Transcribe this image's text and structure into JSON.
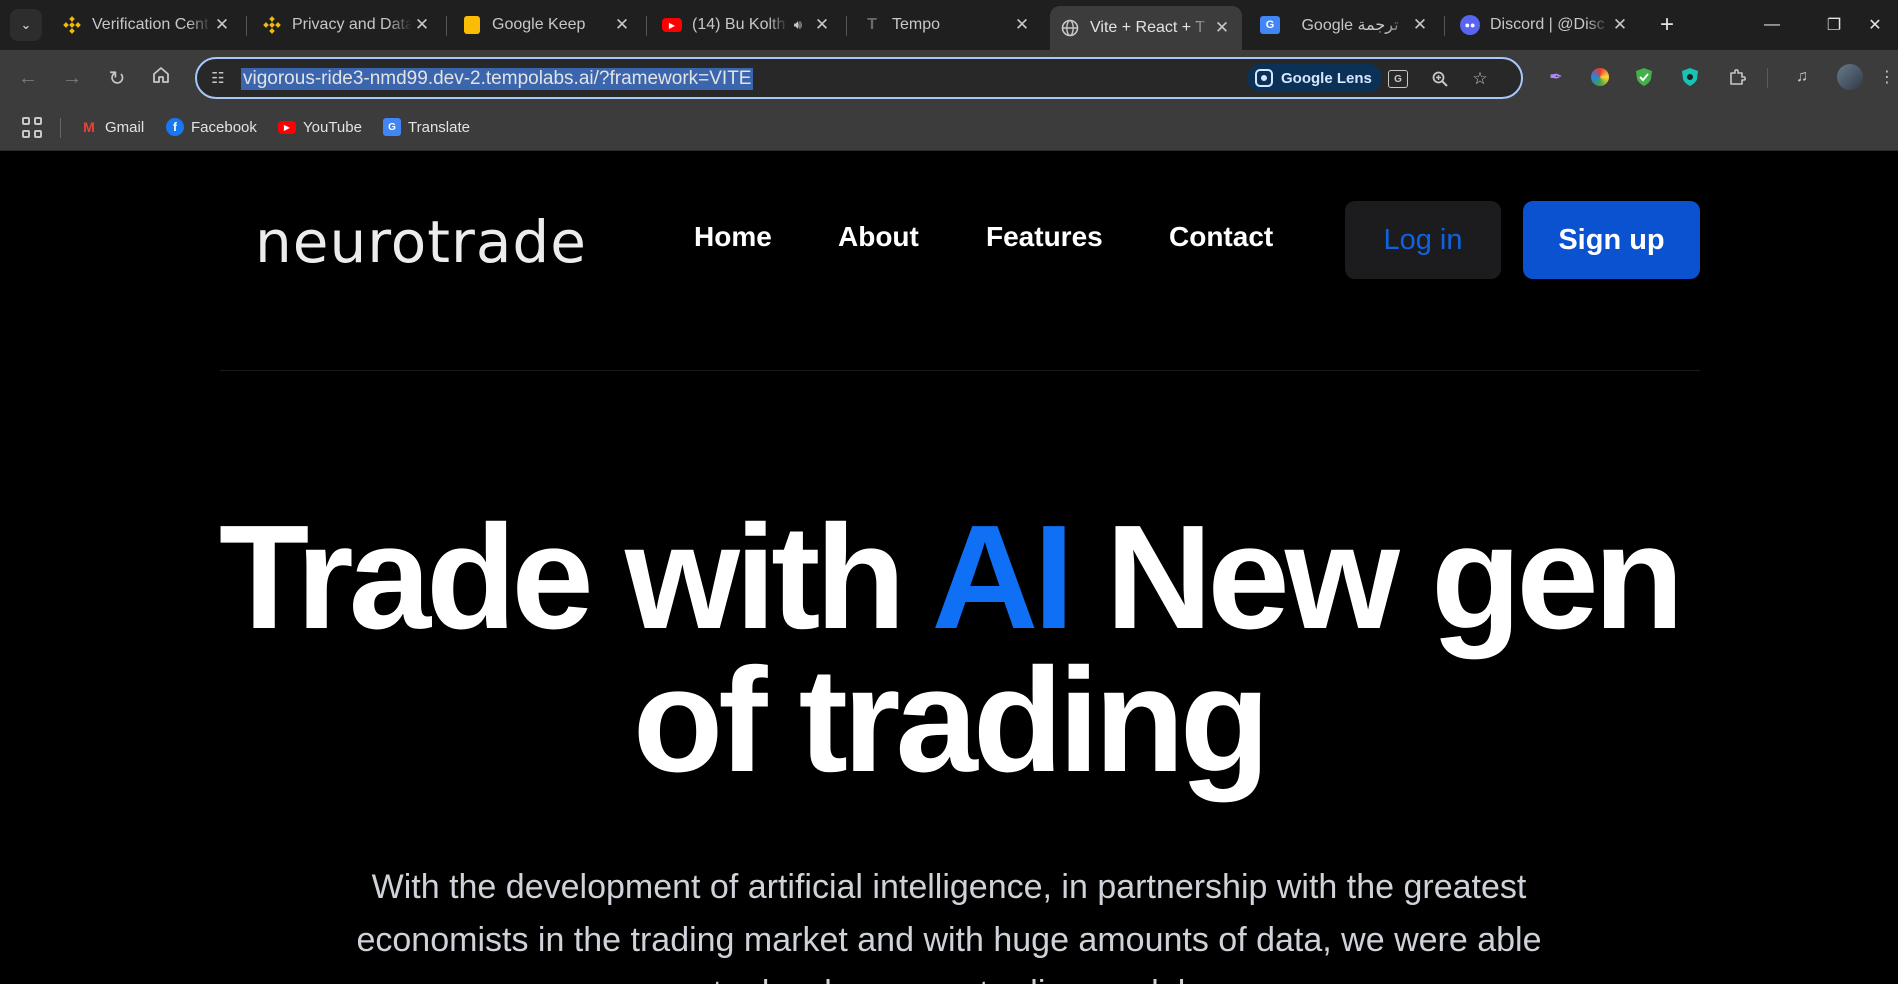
{
  "browser": {
    "tabs": [
      {
        "title": "Verification Cent",
        "icon": "binance-icon"
      },
      {
        "title": "Privacy and Data",
        "icon": "binance-icon"
      },
      {
        "title": "Google Keep",
        "icon": "keep-icon"
      },
      {
        "title": "(14) Bu Kolth",
        "icon": "youtube-icon"
      },
      {
        "title": "Tempo",
        "icon": "tempo-icon"
      },
      {
        "title": "Vite + React + T",
        "icon": "globe-icon",
        "active": true
      },
      {
        "title": "Google ترجمة",
        "icon": "translate-icon"
      },
      {
        "title": "Discord | @Disc",
        "icon": "discord-icon"
      }
    ],
    "url": "vigorous-ride3-nmd99.dev-2.tempolabs.ai/?framework=VITE",
    "lens_label": "Google Lens",
    "bookmarks": [
      {
        "label": "Gmail",
        "icon": "gmail-icon"
      },
      {
        "label": "Facebook",
        "icon": "facebook-icon"
      },
      {
        "label": "YouTube",
        "icon": "youtube-icon"
      },
      {
        "label": "Translate",
        "icon": "translate-icon"
      }
    ]
  },
  "site": {
    "logo": "neurotrade",
    "nav": {
      "home": "Home",
      "about": "About",
      "features": "Features",
      "contact": "Contact"
    },
    "login": "Log in",
    "signup": "Sign up",
    "hero": {
      "part1": "Trade with ",
      "accent": "AI",
      "part2": " New gen",
      "line2": "of trading"
    },
    "subtitle": "With the development of artificial intelligence, in partnership with the greatest economists in the trading market and with huge amounts of data, we were able to develop a new trading model"
  },
  "colors": {
    "accent": "#0f6ff5",
    "signup_bg": "#0b52d1",
    "page_bg": "#000000"
  }
}
